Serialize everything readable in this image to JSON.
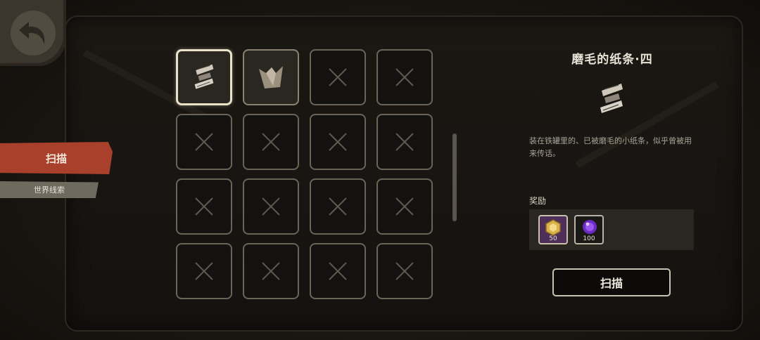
{
  "sidebar": {
    "tabs": [
      {
        "label": "扫描",
        "active": true
      },
      {
        "label": "世界线索",
        "active": false
      }
    ]
  },
  "grid": {
    "cells": [
      {
        "state": "item",
        "icon": "paper-strip-icon",
        "selected": true
      },
      {
        "state": "item",
        "icon": "torn-paper-icon",
        "selected": false
      },
      {
        "state": "empty"
      },
      {
        "state": "empty"
      },
      {
        "state": "empty"
      },
      {
        "state": "empty"
      },
      {
        "state": "empty"
      },
      {
        "state": "empty"
      },
      {
        "state": "empty"
      },
      {
        "state": "empty"
      },
      {
        "state": "empty"
      },
      {
        "state": "empty"
      },
      {
        "state": "empty"
      },
      {
        "state": "empty"
      },
      {
        "state": "empty"
      },
      {
        "state": "empty"
      }
    ]
  },
  "detail": {
    "title": "磨毛的纸条·四",
    "description": "装在铁罐里的、已被磨毛的小纸条，似乎曾被用来传话。",
    "reward_label": "奖励",
    "rewards": [
      {
        "icon": "gold-hexagon-coin-icon",
        "count": "50"
      },
      {
        "icon": "purple-orb-icon",
        "count": "100"
      }
    ],
    "action_label": "扫描"
  },
  "colors": {
    "active_tab": "#a8402c",
    "background": "#1c1915",
    "rare_reward_bg": "#4d2f5a"
  }
}
